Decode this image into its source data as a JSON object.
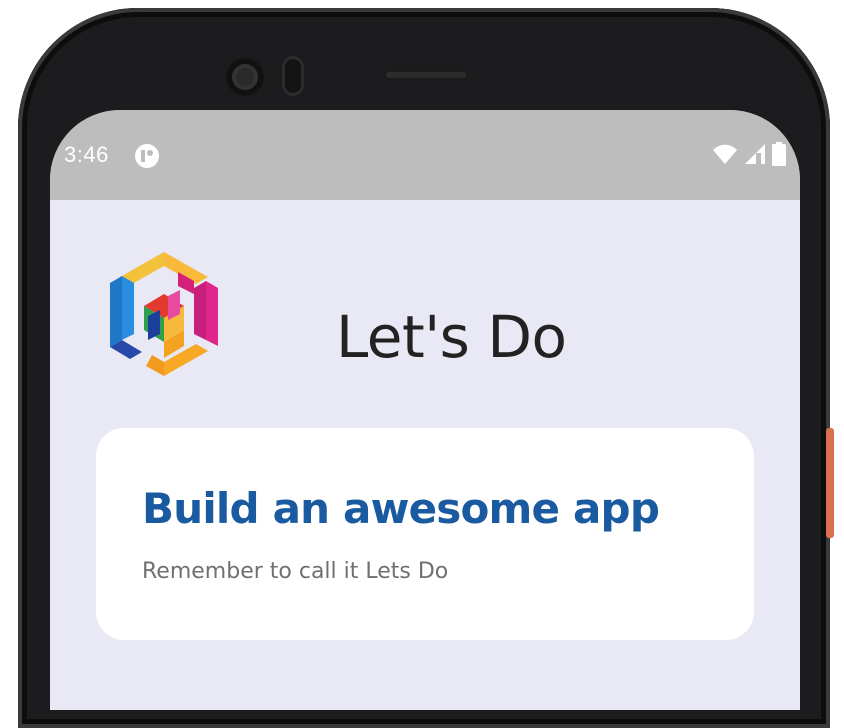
{
  "status_bar": {
    "time": "3:46",
    "notification_icon": "app-notification-icon",
    "icons": [
      "wifi-icon",
      "cell-signal-icon",
      "battery-icon"
    ]
  },
  "app": {
    "title": "Let's Do",
    "logo": "lets-do-logo"
  },
  "card": {
    "title": "Build an awesome app",
    "subtitle": "Remember to call it Lets Do"
  },
  "colors": {
    "screen_bg": "#e8e9f4",
    "status_bar_bg": "#bdbdbd",
    "card_bg": "#ffffff",
    "card_title": "#1a5aa0",
    "card_subtitle": "#707070",
    "app_title": "#222222",
    "frame": "#1c1c1e",
    "side_button": "#d9704e"
  }
}
